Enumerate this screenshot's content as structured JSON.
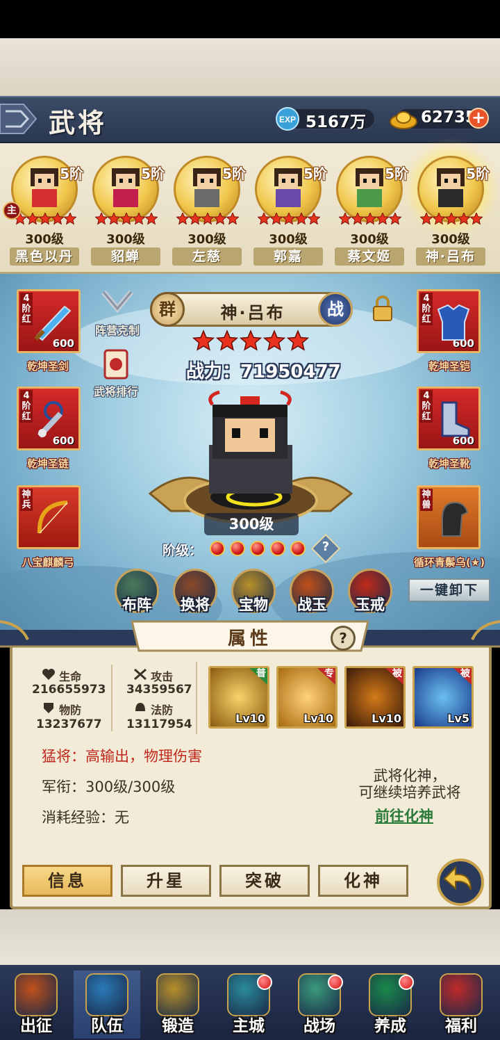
{
  "header": {
    "title": "武将",
    "exp_value": "5167万",
    "gold_value": "62735"
  },
  "roster": [
    {
      "rank": "5阶",
      "level": "300级",
      "name": "黑色以丹",
      "badge": "主",
      "color": "#d43030",
      "selected": false
    },
    {
      "rank": "5阶",
      "level": "300级",
      "name": "貂蝉",
      "badge": "",
      "color": "#c21e4e",
      "selected": false
    },
    {
      "rank": "5阶",
      "level": "300级",
      "name": "左慈",
      "badge": "",
      "color": "#6a6a6a",
      "selected": false
    },
    {
      "rank": "5阶",
      "level": "300级",
      "name": "郭嘉",
      "badge": "",
      "color": "#6a4aa8",
      "selected": false
    },
    {
      "rank": "5阶",
      "level": "300级",
      "name": "蔡文姬",
      "badge": "",
      "color": "#4a9a4a",
      "selected": false
    },
    {
      "rank": "5阶",
      "level": "300级",
      "name": "神·吕布",
      "badge": "",
      "color": "#2a2a2a",
      "selected": true
    }
  ],
  "hero": {
    "faction": "群",
    "name": "神·吕布",
    "type_badge": "战",
    "power_label": "战力：",
    "power": "71950477",
    "level": "300级",
    "stage_label": "阶级：",
    "stars": 5,
    "gems": 5
  },
  "side_buttons": {
    "formation_counter": "阵营克制",
    "ranking": "武将排行"
  },
  "equipment_left": [
    {
      "grade": "4阶红",
      "num": "600",
      "label": "乾坤圣剑",
      "type": "sword"
    },
    {
      "grade": "4阶红",
      "num": "600",
      "label": "乾坤圣链",
      "type": "chain"
    },
    {
      "grade": "神兵",
      "num": "",
      "label": "八宝麒麟弓",
      "type": "bow"
    }
  ],
  "equipment_right": [
    {
      "grade": "4阶红",
      "num": "600",
      "label": "乾坤圣铠",
      "type": "armor"
    },
    {
      "grade": "4阶红",
      "num": "600",
      "label": "乾坤圣靴",
      "type": "boots"
    },
    {
      "grade": "神兽",
      "num": "",
      "label": "循环青鬃乌(★)",
      "type": "horse"
    }
  ],
  "unequip_all": "一键卸下",
  "functions": [
    "布阵",
    "换将",
    "宝物",
    "战玉",
    "玉戒"
  ],
  "attributes": {
    "title": "属性",
    "hp_label": "生命",
    "hp": "216655973",
    "atk_label": "攻击",
    "atk": "34359567",
    "pdef_label": "物防",
    "pdef": "13237677",
    "mdef_label": "法防",
    "mdef": "13117954"
  },
  "skills": [
    {
      "tag": "普",
      "level": "Lv10",
      "tag_color": "#2a8a3a"
    },
    {
      "tag": "专",
      "level": "Lv10",
      "tag_color": "#c02a2a"
    },
    {
      "tag": "被",
      "level": "Lv10",
      "tag_color": "#c02a2a"
    },
    {
      "tag": "被",
      "level": "Lv5",
      "tag_color": "#c02a2a"
    }
  ],
  "info": {
    "role": "猛将：高输出，物理伤害",
    "rank": "军衔：300级/300级",
    "cost": "消耗经验：无",
    "deify_line1": "武将化神，",
    "deify_line2": "可继续培养武将",
    "deify_link": "前往化神"
  },
  "tabs": [
    "信息",
    "升星",
    "突破",
    "化神"
  ],
  "nav": [
    {
      "label": "出征",
      "dot": false,
      "active": false
    },
    {
      "label": "队伍",
      "dot": false,
      "active": true
    },
    {
      "label": "锻造",
      "dot": false,
      "active": false
    },
    {
      "label": "主城",
      "dot": true,
      "active": false
    },
    {
      "label": "战场",
      "dot": true,
      "active": false
    },
    {
      "label": "养成",
      "dot": true,
      "active": false
    },
    {
      "label": "福利",
      "dot": false,
      "active": false
    }
  ],
  "colors": {
    "star_red": "#e8321e",
    "gold": "#f0c64a",
    "link_green": "#2a7a3a",
    "role_red": "#c0281c"
  }
}
